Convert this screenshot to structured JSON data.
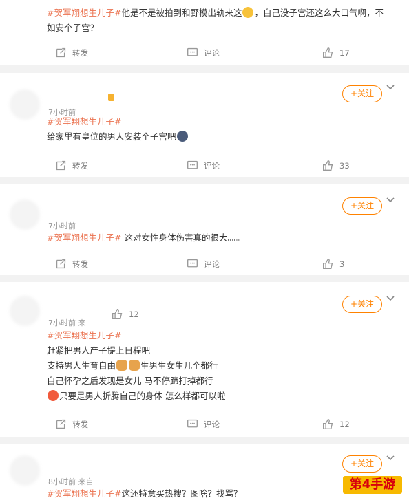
{
  "labels": {
    "repost": "转发",
    "comment": "评论",
    "follow": "+关注"
  },
  "posts": [
    {
      "line1_pre": "",
      "tag": "#贺军翔想生儿子#",
      "line1_post": "他是不是被拍到和野模出轨来这",
      "line1_tail": "，自己没子宫还这么大口气啊，不",
      "line2": "如安个子宫？",
      "likes": "17"
    },
    {
      "time": "7小时前",
      "tag": "#贺军翔想生儿子#",
      "text": "给家里有皇位的男人安装个子宫吧",
      "likes": "33"
    },
    {
      "time": "7小时前",
      "tag": "#贺军翔想生儿子#",
      "text": "这对女性身体伤害真的很大。。。",
      "likes": "3"
    },
    {
      "time": "7小时前 来",
      "tag": "#贺军翔想生儿子#",
      "inline_likes": "12",
      "lines": [
        "赶紧把男人产子提上日程吧",
        "支持男人生育自由",
        "生男生女生几个都行",
        "自己怀孕之后发现是女儿 马不停蹄打掉都行",
        "只要是男人折腾自己的身体 怎么样都可以啦"
      ],
      "likes": "12"
    },
    {
      "time": "8小时前 来自",
      "tag": "#贺军翔想生儿子#",
      "text": "这还特意买热搜？图啥？找骂？"
    }
  ],
  "watermark": "第4手游",
  "colors": {
    "accent": "#ff8200",
    "tag": "#eb7350"
  }
}
